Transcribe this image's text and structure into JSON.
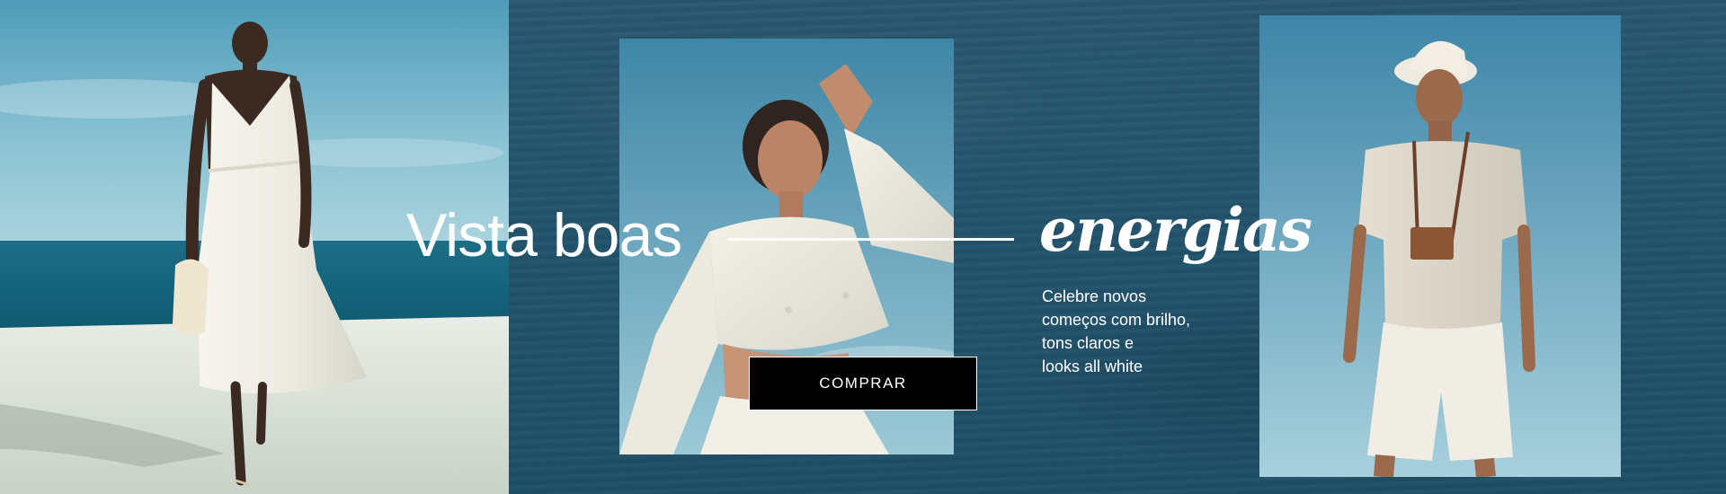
{
  "banner": {
    "headline_main": "Vista boas",
    "headline_accent": "energias",
    "subcopy_lines": [
      "Celebre novos",
      "começos com brilho,",
      "tons claros e",
      "looks all white"
    ],
    "cta_label": "COMPRAR"
  },
  "colors": {
    "background": "#22536b",
    "text": "#ffffff",
    "cta_background": "#000000"
  }
}
